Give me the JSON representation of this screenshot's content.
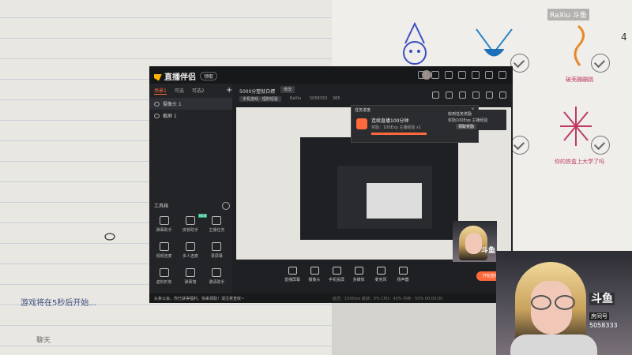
{
  "stream": {
    "status_message": "游戏将在5秒后开始...",
    "chat_label": "聊天",
    "brand_top": "RaXiu 斗鱼",
    "page_number": "4"
  },
  "game_board": {
    "captions": [
      "破壳蹦蹦跳",
      "你的铁盒上大学了吗"
    ]
  },
  "app": {
    "name": "直播伴侣",
    "badge": "领取",
    "scene_tabs": [
      "场景1",
      "可选",
      "可选2"
    ],
    "sources": [
      "摄像头 1",
      "截屏 1"
    ],
    "toolbox_title": "工具箱",
    "tools": [
      {
        "label": "弹幕助手",
        "badge": ""
      },
      {
        "label": "房管助手",
        "badge": ""
      },
      {
        "label": "主播任务",
        "badge": ""
      },
      {
        "label": "视频连麦",
        "badge": "HOT"
      },
      {
        "label": "多人连麦",
        "badge": ""
      },
      {
        "label": "录屏幕",
        "badge": "NEW"
      },
      {
        "label": "虚拟形象",
        "badge": ""
      },
      {
        "label": "弹幕墙",
        "badge": ""
      },
      {
        "label": "邀请助手",
        "badge": ""
      },
      {
        "label": "…",
        "badge": "HOT"
      },
      {
        "label": "…",
        "badge": ""
      },
      {
        "label": "…",
        "badge": ""
      }
    ],
    "room_title": "5000分整就白嫖",
    "edit_label": "修改",
    "category": "手机游戏 · 理财经验",
    "handle": "RaXiu",
    "room_id": "5058333",
    "heat": "365",
    "task_popup": {
      "header": "任务进度",
      "name": "连续直播100分钟",
      "reward": "奖励：100Exp 主播经验 x1",
      "close": "×"
    },
    "reward_popup": {
      "title": "收到任务奖励",
      "text": "奖励100Exp 主播经验",
      "button": "领取奖励"
    },
    "bottom_buttons": [
      "直播屏幕",
      "摄像头",
      "手机投屏",
      "多媒体",
      "麦克风",
      "扬声器"
    ],
    "live_button": "开始直播",
    "notice": "头条公会，你已获得福利，快来领取！请注意查收~",
    "stats": "延迟：1500ms  丢帧：0%  CPU：43%  内存：50%  00:00:00"
  },
  "webcam": {
    "brand_logo": "斗鱼",
    "room_label": "房间号",
    "room_id": "5058333",
    "mini_brand": "斗鱼"
  }
}
